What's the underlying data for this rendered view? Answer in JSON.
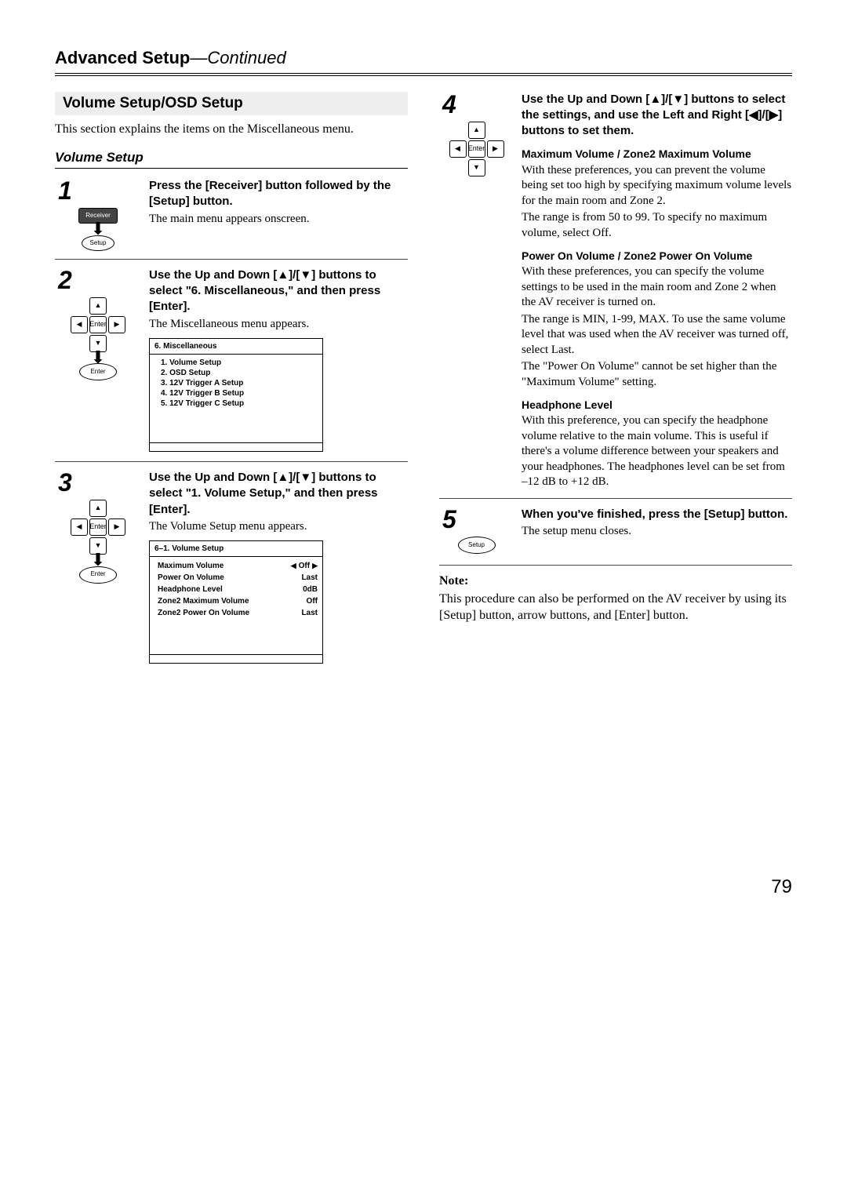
{
  "header": {
    "main": "Advanced Setup",
    "cont": "—Continued"
  },
  "section_title": "Volume Setup/OSD Setup",
  "intro": "This section explains the items on the Miscellaneous menu.",
  "sub_head": "Volume Setup",
  "icons": {
    "receiver": "Receiver",
    "setup": "Setup",
    "enter": "Enter",
    "up_sym": "▲",
    "down_sym": "▼",
    "left_sym": "◀",
    "right_sym": "▶"
  },
  "steps": {
    "s1": {
      "num": "1",
      "title": "Press the [Receiver] button followed by the [Setup] button.",
      "text": "The main menu appears onscreen."
    },
    "s2": {
      "num": "2",
      "title": "Use the Up and Down [▲]/[▼] buttons to select \"6. Miscellaneous,\" and then press [Enter].",
      "text": "The Miscellaneous menu appears.",
      "osd_title": "6.  Miscellaneous",
      "osd_items": [
        "1.  Volume Setup",
        "2.  OSD Setup",
        "3.  12V Trigger A Setup",
        "4.  12V Trigger B Setup",
        "5.  12V Trigger C Setup"
      ]
    },
    "s3": {
      "num": "3",
      "title": "Use the Up and Down [▲]/[▼] buttons to select \"1. Volume Setup,\" and then press [Enter].",
      "text": "The Volume Setup menu appears.",
      "osd_title": "6–1.  Volume Setup",
      "osd_rows": [
        {
          "label": "Maximum Volume",
          "val": "Off",
          "arrows": true
        },
        {
          "label": "Power On Volume",
          "val": "Last"
        },
        {
          "label": "Headphone Level",
          "val": "0dB"
        },
        {
          "label": "Zone2 Maximum Volume",
          "val": "Off"
        },
        {
          "label": "Zone2 Power On Volume",
          "val": "Last"
        }
      ]
    },
    "s4": {
      "num": "4",
      "title": "Use the Up and Down [▲]/[▼] buttons to select the settings, and use the Left and Right [◀]/[▶] buttons to set them.",
      "blocks": {
        "b1": {
          "head": "Maximum Volume / Zone2 Maximum Volume",
          "t1": "With these preferences, you can prevent the volume being set too high by specifying maximum volume levels for the main room and Zone 2.",
          "t2": "The range is from 50 to 99. To specify no maximum volume, select Off."
        },
        "b2": {
          "head": "Power On Volume / Zone2 Power On Volume",
          "t1": "With these preferences, you can specify the volume settings to be used in the main room and Zone 2 when the AV receiver is turned on.",
          "t2": "The range is MIN, 1-99, MAX. To use the same volume level that was used when the AV receiver was turned off, select Last.",
          "t3": "The \"Power On Volume\" cannot be set higher than the \"Maximum Volume\" setting."
        },
        "b3": {
          "head": "Headphone Level",
          "t1": "With this preference, you can specify the headphone volume relative to the main volume. This is useful if there's a volume difference between your speakers and your headphones. The headphones level can be set from –12 dB to +12 dB."
        }
      }
    },
    "s5": {
      "num": "5",
      "title": "When you've finished, press the [Setup] button.",
      "text": "The setup menu closes."
    }
  },
  "note": {
    "head": "Note:",
    "text": "This procedure can also be performed on the AV receiver by using its [Setup] button, arrow buttons, and [Enter] button."
  },
  "page_num": "79"
}
